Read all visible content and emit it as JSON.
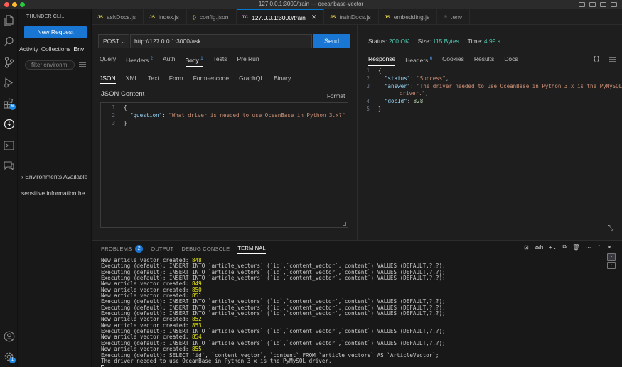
{
  "window": {
    "title": "127.0.0.1:3000/train — oceanbase-vector"
  },
  "activity_bar": {
    "icons": [
      "files-icon",
      "search-icon",
      "source-control-icon",
      "run-debug-icon",
      "extensions-icon",
      "thunder-client-icon",
      "remote-explorer-icon",
      "chat-icon",
      "account-icon",
      "settings-gear-icon"
    ],
    "extensions_badge": "6",
    "settings_badge": "1"
  },
  "sidebar": {
    "title": "THUNDER CLI...",
    "new_request_label": "New Request",
    "tabs": [
      "Activity",
      "Collections",
      "Env"
    ],
    "filter_placeholder": "filter environm",
    "environments_available": "› Environments Available",
    "sensitive_info": "sensitive information he"
  },
  "editor_tabs": [
    {
      "icon": "JS",
      "type": "js",
      "label": "askDocs.js"
    },
    {
      "icon": "JS",
      "type": "js",
      "label": "index.js"
    },
    {
      "icon": "{}",
      "type": "json",
      "label": "config.json"
    },
    {
      "icon": "TC",
      "type": "tc",
      "label": "127.0.0.1:3000/train",
      "active": true
    },
    {
      "icon": "JS",
      "type": "js",
      "label": "trainDocs.js"
    },
    {
      "icon": "JS",
      "type": "js",
      "label": "embedding.js"
    },
    {
      "icon": "⚙",
      "type": "env",
      "label": ".env"
    }
  ],
  "request": {
    "method": "POST",
    "url": "http://127.0.0.1:3000/ask",
    "send_label": "Send",
    "tabs": [
      "Query",
      "Headers",
      "Auth",
      "Body",
      "Tests",
      "Pre Run"
    ],
    "headers_count": "2",
    "body_count": "1",
    "body_types": [
      "JSON",
      "XML",
      "Text",
      "Form",
      "Form-encode",
      "GraphQL",
      "Binary"
    ],
    "json_content_label": "JSON Content",
    "format_label": "Format",
    "body_lines": [
      {
        "n": "1",
        "text": "{"
      },
      {
        "n": "2",
        "key": "\"question\"",
        "value": "\"What driver is needed to use OceanBase in Python 3.x?\""
      },
      {
        "n": "3",
        "text": "}"
      }
    ]
  },
  "response": {
    "status_label": "Status:",
    "status_value": "200 OK",
    "size_label": "Size:",
    "size_value": "115 Bytes",
    "time_label": "Time:",
    "time_value": "4.99 s",
    "tabs": [
      "Response",
      "Headers",
      "Cookies",
      "Results",
      "Docs"
    ],
    "headers_count": "6",
    "braces_label": "{ }",
    "body_lines": [
      {
        "n": "1",
        "text": "{"
      },
      {
        "n": "2",
        "key": "\"status\"",
        "value": "\"Success\"",
        "trail": ","
      },
      {
        "n": "3",
        "key": "\"answer\"",
        "value": "\"The driver needed to use OceanBase in Python 3.x is the PyMySQL"
      },
      {
        "n": "",
        "wrap": "driver.\"",
        "trail": ","
      },
      {
        "n": "4",
        "key": "\"docId\"",
        "num": "828"
      },
      {
        "n": "5",
        "text": "}"
      }
    ]
  },
  "panel": {
    "tabs": [
      "PROBLEMS",
      "OUTPUT",
      "DEBUG CONSOLE",
      "TERMINAL"
    ],
    "problems_count": "2",
    "shell_label": "zsh",
    "terminal_lines": [
      {
        "prefix": "New article vector created: ",
        "num": "848"
      },
      {
        "text": "Executing (default): INSERT INTO `article_vectors` (`id`,`content_vector`,`content`) VALUES (DEFAULT,?,?);"
      },
      {
        "text": "Executing (default): INSERT INTO `article_vectors` (`id`,`content_vector`,`content`) VALUES (DEFAULT,?,?);"
      },
      {
        "text": "Executing (default): INSERT INTO `article_vectors` (`id`,`content_vector`,`content`) VALUES (DEFAULT,?,?);"
      },
      {
        "prefix": "New article vector created: ",
        "num": "849"
      },
      {
        "prefix": "New article vector created: ",
        "num": "850"
      },
      {
        "prefix": "New article vector created: ",
        "num": "851"
      },
      {
        "text": "Executing (default): INSERT INTO `article_vectors` (`id`,`content_vector`,`content`) VALUES (DEFAULT,?,?);"
      },
      {
        "text": "Executing (default): INSERT INTO `article_vectors` (`id`,`content_vector`,`content`) VALUES (DEFAULT,?,?);"
      },
      {
        "text": "Executing (default): INSERT INTO `article_vectors` (`id`,`content_vector`,`content`) VALUES (DEFAULT,?,?);"
      },
      {
        "prefix": "New article vector created: ",
        "num": "852"
      },
      {
        "prefix": "New article vector created: ",
        "num": "853"
      },
      {
        "text": "Executing (default): INSERT INTO `article_vectors` (`id`,`content_vector`,`content`) VALUES (DEFAULT,?,?);"
      },
      {
        "prefix": "New article vector created: ",
        "num": "854"
      },
      {
        "text": "Executing (default): INSERT INTO `article_vectors` (`id`,`content_vector`,`content`) VALUES (DEFAULT,?,?);"
      },
      {
        "prefix": "New article vector created: ",
        "num": "855"
      },
      {
        "text": "Executing (default): SELECT `id`, `content_vector`, `content` FROM `article_vectors` AS `ArticleVector`;"
      },
      {
        "text": "The driver needed to use OceanBase in Python 3.x is the PyMySQL driver."
      }
    ]
  }
}
